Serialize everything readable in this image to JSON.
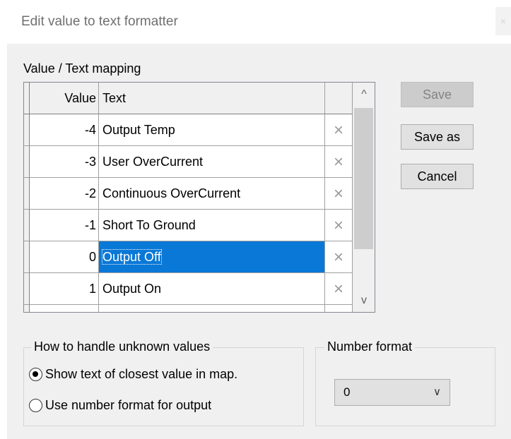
{
  "window": {
    "title": "Edit value to text formatter",
    "close_glyph": "×"
  },
  "mapping": {
    "label": "Value / Text mapping",
    "headers": {
      "value": "Value",
      "text": "Text"
    },
    "rows": [
      {
        "value": "-4",
        "text": "Output Temp",
        "selected": false
      },
      {
        "value": "-3",
        "text": "User OverCurrent",
        "selected": false
      },
      {
        "value": "-2",
        "text": "Continuous OverCurrent",
        "selected": false
      },
      {
        "value": "-1",
        "text": "Short To Ground",
        "selected": false
      },
      {
        "value": "0",
        "text": "Output Off",
        "selected": true
      },
      {
        "value": "1",
        "text": "Output On",
        "selected": false
      },
      {
        "value": "",
        "text": "",
        "selected": false
      }
    ],
    "delete_icon": "×",
    "scroll_up": "^",
    "scroll_down": "v"
  },
  "buttons": {
    "save": "Save",
    "save_as": "Save as",
    "cancel": "Cancel"
  },
  "unknown_values": {
    "title": "How to handle unknown values",
    "option_closest": "Show text of closest value in map.",
    "option_number": "Use number format for output",
    "selected": "option_closest"
  },
  "number_format": {
    "title": "Number format",
    "value": "0",
    "arrow": "∨"
  },
  "colors": {
    "selection": "#0a78d7",
    "dialog_bg": "#f0f0f0"
  }
}
